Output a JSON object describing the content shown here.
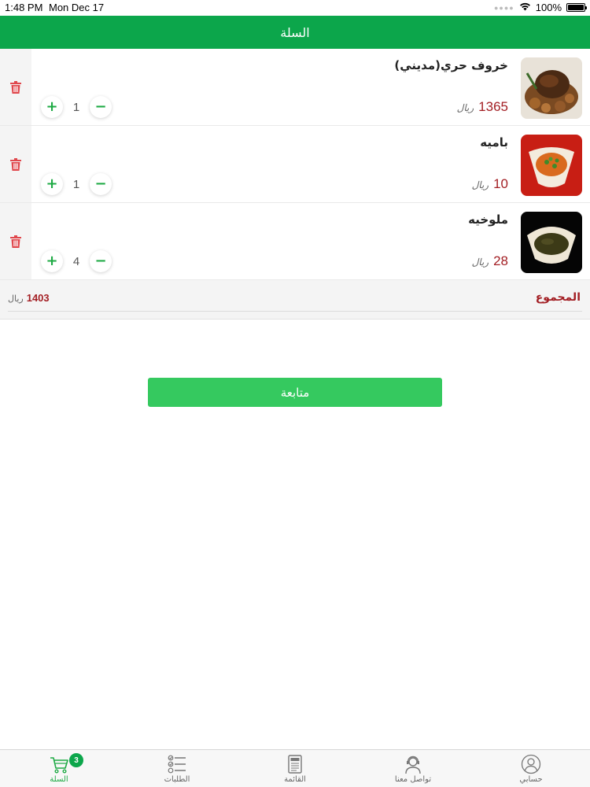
{
  "status_bar": {
    "time": "1:48 PM",
    "date": "Mon Dec 17",
    "battery": "100%"
  },
  "header": {
    "title": "السلة"
  },
  "cart": {
    "items": [
      {
        "name": "خروف حري(مديني)",
        "price": "1365",
        "currency": "ريال",
        "quantity": "1"
      },
      {
        "name": "باميه",
        "price": "10",
        "currency": "ريال",
        "quantity": "1"
      },
      {
        "name": "ملوخيه",
        "price": "28",
        "currency": "ريال",
        "quantity": "4"
      }
    ],
    "total_label": "المجموع",
    "total_value": "1403",
    "total_currency": "ريال"
  },
  "continue_label": "متابعة",
  "tabs": [
    {
      "label": "السلة",
      "icon": "cart-icon",
      "badge": "3",
      "active": true
    },
    {
      "label": "الطلبات",
      "icon": "checklist-icon"
    },
    {
      "label": "القائمة",
      "icon": "menu-book-icon"
    },
    {
      "label": "تواصل معنا",
      "icon": "support-agent-icon"
    },
    {
      "label": "حسابي",
      "icon": "user-icon"
    }
  ],
  "colors": {
    "header": "#0ca64b",
    "button": "#35c95f",
    "price": "#a31f24",
    "accent": "#1eaa44"
  }
}
